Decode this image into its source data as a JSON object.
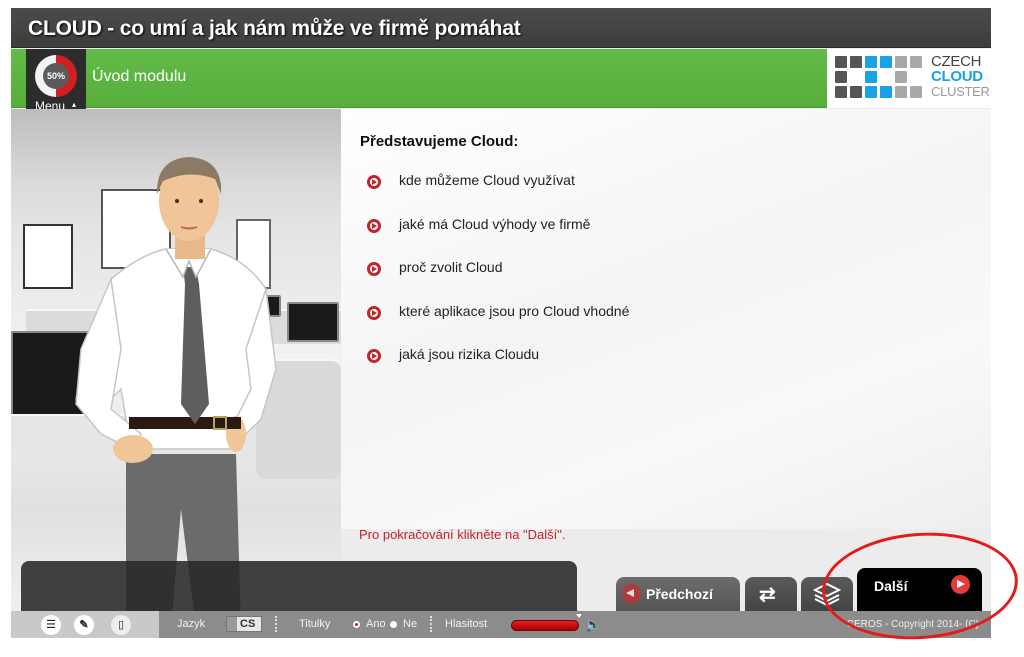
{
  "header": {
    "title": "CLOUD - co umí a jak nám může ve firmě pomáhat",
    "section_title": "Úvod modulu"
  },
  "menu": {
    "progress_percent": 50,
    "progress_label": "50%",
    "label": "Menu",
    "caret": "▴"
  },
  "logo": {
    "line1": "CZECH",
    "line2": "CLOUD",
    "line3": "CLUSTER",
    "colors": {
      "dark": "#555555",
      "blue": "#19a3e6",
      "light": "#a8a8a8"
    },
    "grid": [
      [
        "dark",
        "dark",
        "blue",
        "blue",
        "light",
        "light"
      ],
      [
        "dark",
        "none",
        "blue",
        "none",
        "light",
        "none"
      ],
      [
        "dark",
        "dark",
        "blue",
        "blue",
        "light",
        "light"
      ]
    ]
  },
  "content": {
    "heading": "Představujeme Cloud:",
    "bullets": [
      "kde můžeme Cloud využívat",
      "jaké má Cloud výhody ve firmě",
      "proč zvolit Cloud",
      "které aplikace jsou pro Cloud vhodné",
      "jaká jsou rizika Cloudu"
    ],
    "instruction": "Pro pokračování klikněte na \"Další\"."
  },
  "nav": {
    "prev_label": "Předchozí",
    "repeat_icon": "⇄",
    "next_label": "Další"
  },
  "bottombar": {
    "language_label": "Jazyk",
    "language_value": "CS",
    "subtitles_label": "Titulky",
    "subtitles_yes": "Ano",
    "subtitles_no": "Ne",
    "subtitles_selected": "Ano",
    "volume_label": "Hlasitost",
    "volume_level_percent": 100,
    "copyright": "CEROS - Copyright 2014- (C)"
  },
  "colors": {
    "accent_green": "#5cb443",
    "accent_red": "#c8202b",
    "title_bar": "#434345"
  }
}
